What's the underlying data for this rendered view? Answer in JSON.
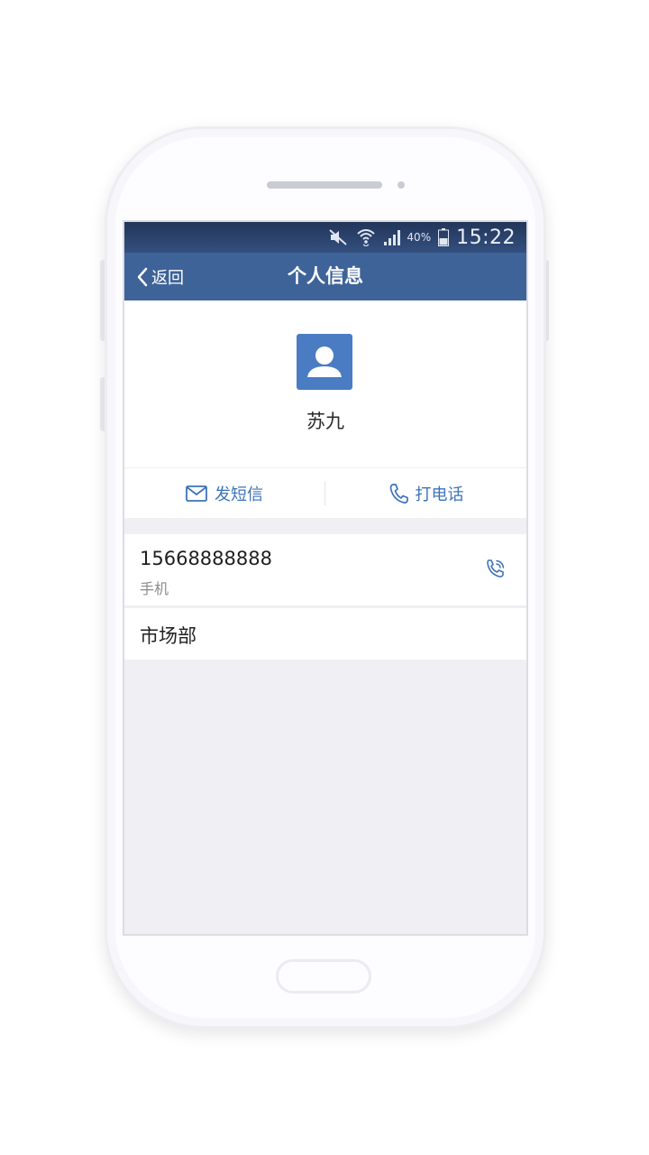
{
  "status_bar": {
    "battery_percent": "40%",
    "time": "15:22",
    "icons": [
      "mute-icon",
      "wifi-icon",
      "signal-icon",
      "battery-icon"
    ]
  },
  "nav": {
    "back_label": "返回",
    "title": "个人信息"
  },
  "profile": {
    "name": "苏九",
    "avatar_icon": "user-avatar-icon"
  },
  "actions": {
    "sms_label": "发短信",
    "call_label": "打电话"
  },
  "contact": {
    "phone_number": "15668888888",
    "phone_type": "手机",
    "department": "市场部"
  },
  "colors": {
    "nav_bar": "#3e6399",
    "accent": "#3d73b8",
    "avatar_bg": "#4a7cc4",
    "page_bg": "#efeff4"
  }
}
